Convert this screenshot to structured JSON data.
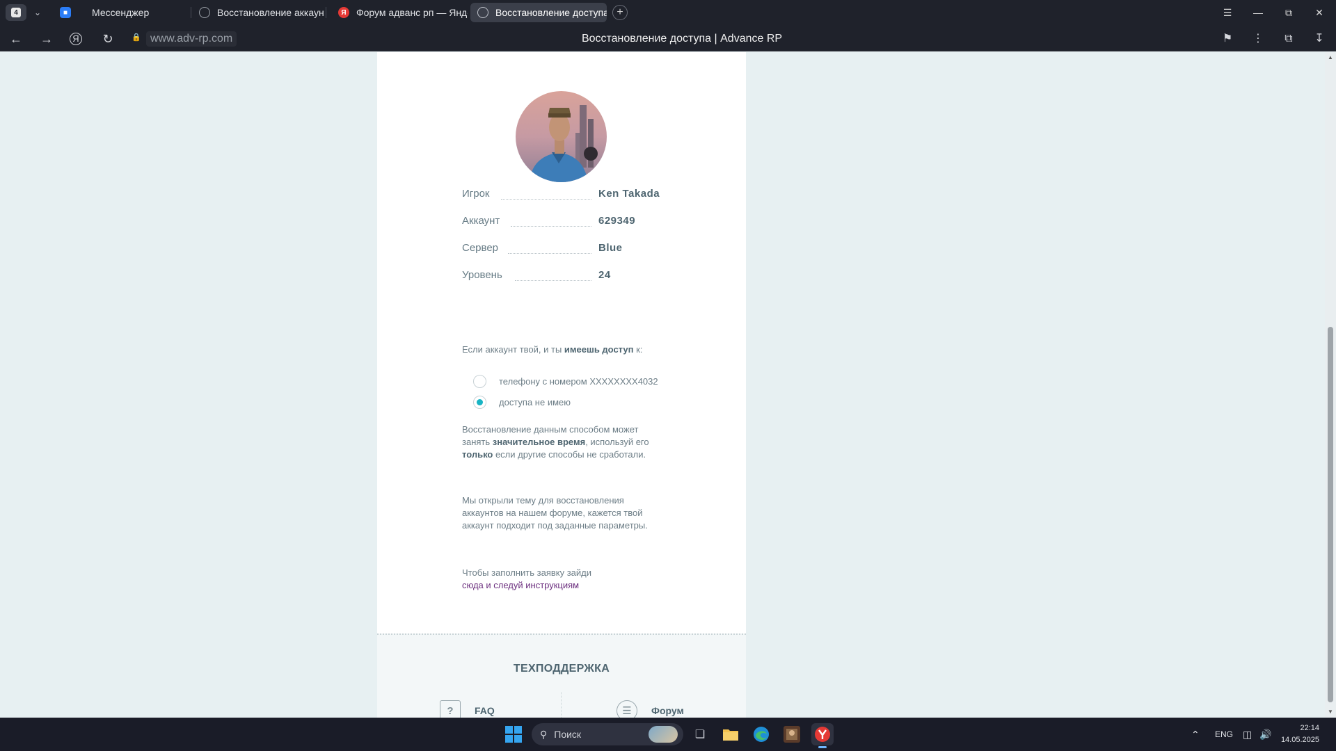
{
  "browser": {
    "tab_count": "4",
    "tabs": [
      {
        "label": "Мессенджер"
      },
      {
        "label": "Восстановление аккаунта"
      },
      {
        "label": "Форум адванс рп — Яндекс"
      },
      {
        "label": "Восстановление доступа"
      }
    ],
    "url": "www.adv-rp.com",
    "page_title": "Восстановление доступа | Advance RP",
    "yandex_glyph": "Я"
  },
  "profile": {
    "rows": [
      {
        "label": "Игрок",
        "value": "Ken Takada"
      },
      {
        "label": "Аккаунт",
        "value": "629349"
      },
      {
        "label": "Сервер",
        "value": "Blue"
      },
      {
        "label": "Уровень",
        "value": "24"
      }
    ]
  },
  "access": {
    "question_prefix": "Если аккаунт твой, и ты ",
    "question_bold": "имеешь доступ",
    "question_suffix": " к:",
    "options": [
      {
        "label": "телефону с номером XXXXXXXX4032",
        "selected": false
      },
      {
        "label": "доступа не имею",
        "selected": true
      }
    ]
  },
  "notice": {
    "p1_a": "Восстановление данным способом может занять ",
    "p1_b": "значительное время",
    "p1_c": ", используй его ",
    "p1_d": "только",
    "p1_e": " если другие способы не сработали.",
    "p2": "Мы открыли тему для восстановления аккаунтов на нашем форуме, кажется твой аккаунт подходит под заданные параметры.",
    "p3_text": "Чтобы заполнить заявку зайди",
    "p3_link": "сюда и следуй инструкциям"
  },
  "support": {
    "title": "ТЕХПОДДЕРЖКА",
    "faq_label": "FAQ",
    "forum_label": "Форум"
  },
  "taskbar": {
    "search_placeholder": "Поиск",
    "language": "ENG",
    "time": "22:14",
    "date": "14.05.2025"
  },
  "colors": {
    "accent_radio": "#18b4c4",
    "link": "#6b2e7e",
    "page_bg": "#e7f0f2"
  }
}
